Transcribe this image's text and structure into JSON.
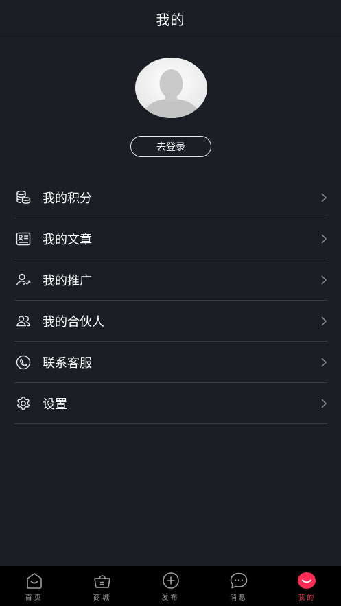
{
  "header": {
    "title": "我的"
  },
  "profile": {
    "login_label": "去登录"
  },
  "menu": [
    {
      "label": "我的积分",
      "icon": "coins-stack-icon"
    },
    {
      "label": "我的文章",
      "icon": "article-card-icon"
    },
    {
      "label": "我的推广",
      "icon": "user-trend-icon"
    },
    {
      "label": "我的合伙人",
      "icon": "partners-icon"
    },
    {
      "label": "联系客服",
      "icon": "phone-service-icon"
    },
    {
      "label": "设置",
      "icon": "gear-icon"
    }
  ],
  "tabbar": {
    "active": 4,
    "tabs": [
      {
        "label": "首页",
        "icon": "home-smile-icon"
      },
      {
        "label": "商城",
        "icon": "shopping-basket-icon"
      },
      {
        "label": "发布",
        "icon": "add-circle-icon"
      },
      {
        "label": "消息",
        "icon": "chat-bubble-icon"
      },
      {
        "label": "我的",
        "icon": "profile-smile-icon"
      }
    ]
  },
  "colors": {
    "background": "#1c1e26",
    "accent": "#ff2d55",
    "tabbar": "#000000"
  }
}
